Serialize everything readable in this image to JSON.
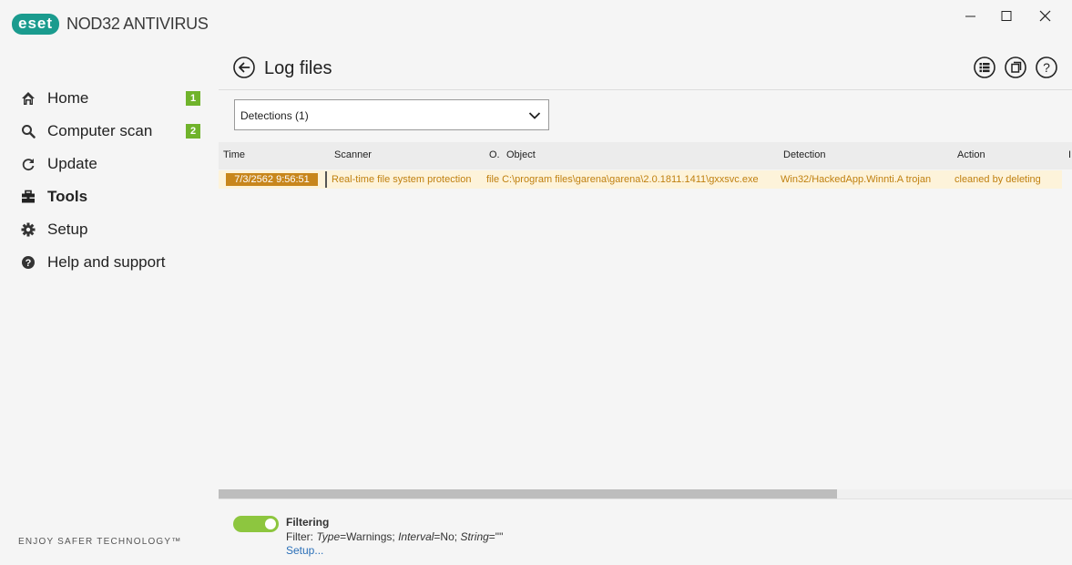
{
  "app": {
    "logo_badge": "eset",
    "logo_text": "NOD32 ANTIVIRUS",
    "tagline": "ENJOY SAFER TECHNOLOGY™"
  },
  "window_controls": {
    "minimize": "minimize-icon",
    "maximize": "maximize-icon",
    "close": "close-icon"
  },
  "sidebar": {
    "items": [
      {
        "label": "Home",
        "icon": "home-icon",
        "badge": "1"
      },
      {
        "label": "Computer scan",
        "icon": "search-icon",
        "badge": "2"
      },
      {
        "label": "Update",
        "icon": "refresh-icon"
      },
      {
        "label": "Tools",
        "icon": "toolbox-icon",
        "active": true
      },
      {
        "label": "Setup",
        "icon": "gear-icon"
      },
      {
        "label": "Help and support",
        "icon": "question-icon"
      }
    ]
  },
  "header": {
    "title": "Log files",
    "icons": [
      "list-icon",
      "copy-icon",
      "help-icon"
    ]
  },
  "log_select": {
    "label": "Detections",
    "count": "(1)"
  },
  "table": {
    "columns": [
      "Time",
      "Scanner",
      "O.",
      "Object",
      "Detection",
      "Action",
      "I"
    ],
    "rows": [
      {
        "time": "7/3/2562 9:56:51",
        "scanner": "Real-time file system protection",
        "object": "file C:\\program files\\garena\\garena\\2.0.1811.1411\\gxxsvc.exe",
        "detection": "Win32/HackedApp.Winnti.A trojan",
        "action": "cleaned by deleting"
      }
    ]
  },
  "filtering": {
    "title": "Filtering",
    "desc_prefix": "Filter: ",
    "type_key": "Type",
    "type_val": "=Warnings; ",
    "interval_key": "Interval",
    "interval_val": "=No; ",
    "string_key": "String",
    "string_val": "=\"\"",
    "setup_link": "Setup...",
    "enabled": true
  },
  "colors": {
    "brand": "#1a9b8e",
    "badge": "#70b32b",
    "highlight_text": "#c08010",
    "highlight_row": "#fdf3da",
    "toggle_on": "#8dc63f"
  }
}
